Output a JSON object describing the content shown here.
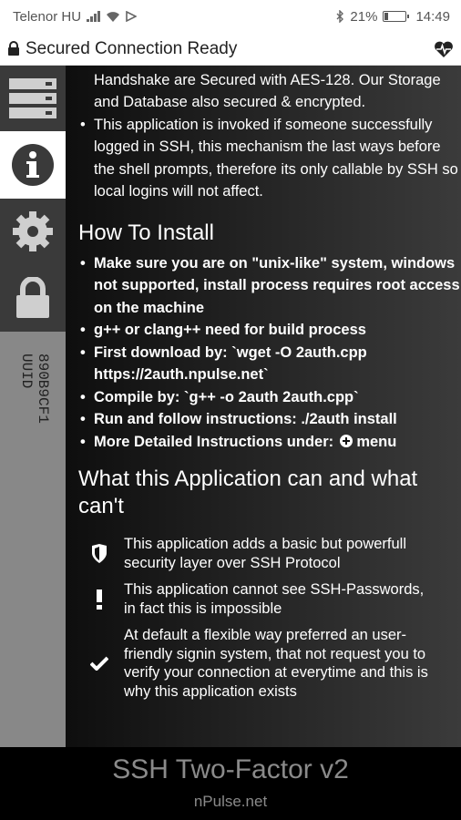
{
  "status_bar": {
    "carrier": "Telenor HU",
    "battery": "21%",
    "battery_level": 0.21,
    "time": "14:49",
    "icons": [
      "signal-icon",
      "wifi-icon",
      "cast-icon",
      "bluetooth-icon",
      "battery-icon"
    ]
  },
  "titlebar": {
    "title": "Secured Connection Ready",
    "left_icon": "lock-icon",
    "right_icon": "heartbeat-icon"
  },
  "sidebar": {
    "items": [
      {
        "name": "servers",
        "icon": "server-list-icon",
        "active": false
      },
      {
        "name": "info",
        "icon": "info-icon",
        "active": true
      },
      {
        "name": "settings",
        "icon": "gear-icon",
        "active": false
      },
      {
        "name": "security",
        "icon": "lock-icon",
        "active": false
      }
    ],
    "uid_label": "UUID",
    "uid_value": "890B9CF1"
  },
  "content": {
    "intro_bullets": [
      "using WebView, any data except the LOGIN and Handshake are Secured with AES-128. Our Storage and Database also secured & encrypted.",
      "This application is invoked if someone successfully logged in SSH, this mechanism the last ways before the shell prompts, therefore its only callable by SSH so local logins will not affect."
    ],
    "install_heading": "How To Install",
    "install_bullets": [
      "Make sure you are on \"unix-like\" system, windows not supported, install process requires root access on the machine",
      "g++ or clang++ need for build process",
      "First download by: `wget -O 2auth.cpp https://2auth.npulse.net`",
      "Compile by: `g++ -o 2auth 2auth.cpp`",
      "Run and follow instructions: ./2auth install"
    ],
    "more_prefix": "More Detailed Instructions under:",
    "more_suffix": "menu",
    "more_icon": "plus-circle-icon",
    "can_heading": "What this Application can and what can't",
    "features": [
      {
        "icon": "shield-icon",
        "text": "This application adds a basic but powerfull security layer over SSH Protocol"
      },
      {
        "icon": "exclamation-icon",
        "text": "This application cannot see SSH-Passwords, in fact this is impossible"
      },
      {
        "icon": "check-icon",
        "text": "At default a flexible way preferred an user-friendly signin system, that not request you to verify your connection at everytime and this is why this application exists"
      }
    ]
  },
  "footer": {
    "title": "SSH Two-Factor v2",
    "subtitle": "nPulse.net"
  }
}
